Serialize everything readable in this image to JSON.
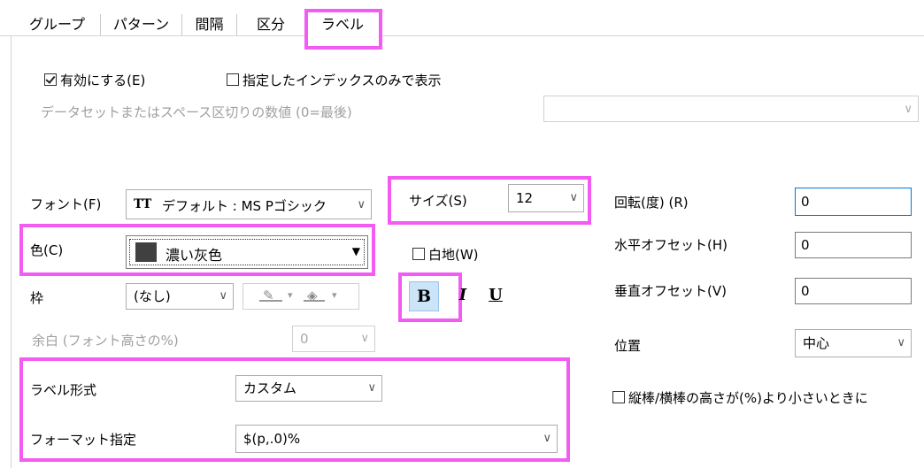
{
  "tabs": [
    "グループ",
    "パターン",
    "間隔",
    "区分",
    "ラベル"
  ],
  "enable": {
    "label": "有効にする(E)",
    "checked": true
  },
  "index_only": {
    "label": "指定したインデックスのみで表示",
    "checked": false
  },
  "dataset_hint": "データセットまたはスペース区切りの数値 (0=最後)",
  "font": {
    "label": "フォント(F)",
    "icon": "TT",
    "value": "デフォルト : MS Pゴシック"
  },
  "size": {
    "label": "サイズ(S)",
    "value": "12"
  },
  "rotation": {
    "label": "回転(度) (R)",
    "value": "0"
  },
  "color": {
    "label": "色(C)",
    "value": "濃い灰色",
    "swatch": "#404040"
  },
  "white_bg": {
    "label": "白地(W)",
    "checked": false
  },
  "h_offset": {
    "label": "水平オフセット(H)",
    "value": "0"
  },
  "frame": {
    "label": "枠",
    "value": "(なし)"
  },
  "style_buttons": {
    "bold": "B",
    "italic": "I",
    "underline": "U"
  },
  "v_offset": {
    "label": "垂直オフセット(V)",
    "value": "0"
  },
  "margin": {
    "label": "余白 (フォント高さの%)",
    "value": "0"
  },
  "position": {
    "label": "位置",
    "value": "中心"
  },
  "label_format": {
    "label": "ラベル形式",
    "value": "カスタム"
  },
  "bar_height_check": {
    "label": "縦棒/横棒の高さが(%)より小さいときに",
    "checked": false
  },
  "format_spec": {
    "label": "フォーマット指定",
    "value": "$(p,.0)%"
  },
  "highlight_color": "#f25cf2"
}
